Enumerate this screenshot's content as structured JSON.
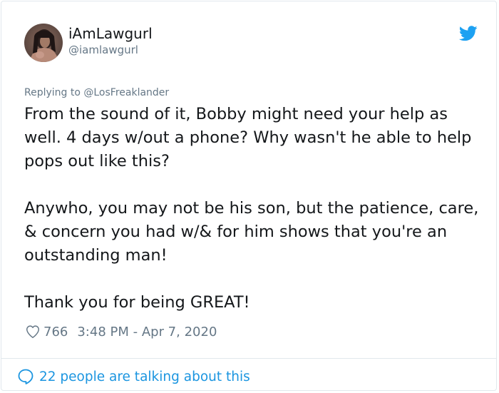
{
  "tweet": {
    "author": {
      "display_name": "iAmLawgurl",
      "handle": "@iamlawgurl",
      "avatar_icon": "user-avatar"
    },
    "brand_icon": "twitter-bird-icon",
    "replying_to": "Replying to @LosFreaklander",
    "paragraphs": [
      "From the sound of it, Bobby might need your help as well. 4 days w/out a phone? Why wasn't he able to help pops out like this?",
      "Anywho, you may not be his son, but the patience, care, & concern you had w/& for him shows that you're an outstanding man!",
      "Thank you for being GREAT!"
    ],
    "likes": "766",
    "timestamp": "3:48 PM - Apr 7, 2020",
    "footer_link": "22 people are talking about this"
  },
  "colors": {
    "twitter_blue": "#1b95e0",
    "text": "#14171a",
    "muted": "#657786",
    "border": "#e1e8ed"
  }
}
